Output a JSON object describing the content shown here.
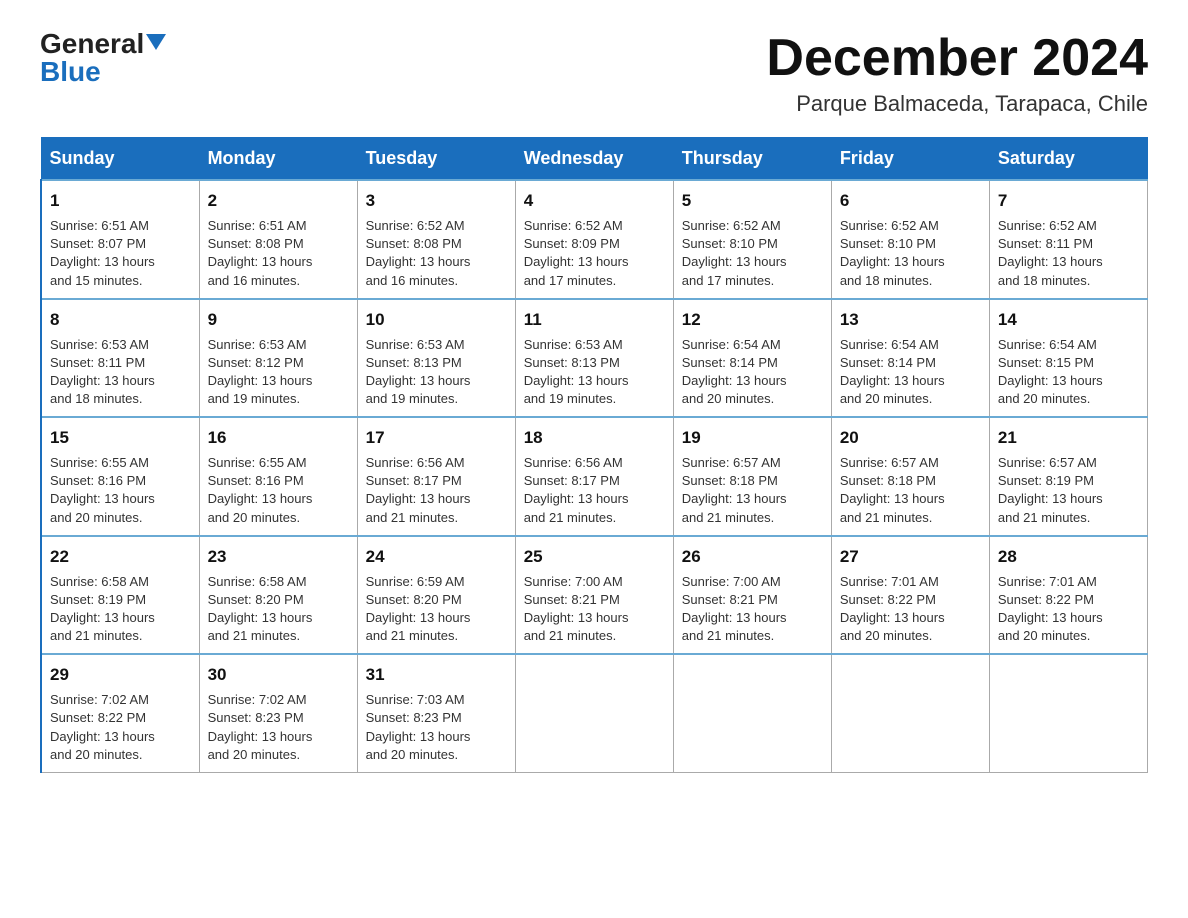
{
  "header": {
    "logo_general": "General",
    "logo_blue": "Blue",
    "title": "December 2024",
    "location": "Parque Balmaceda, Tarapaca, Chile"
  },
  "days_of_week": [
    "Sunday",
    "Monday",
    "Tuesday",
    "Wednesday",
    "Thursday",
    "Friday",
    "Saturday"
  ],
  "weeks": [
    [
      {
        "day": "1",
        "sunrise": "6:51 AM",
        "sunset": "8:07 PM",
        "daylight": "13 hours and 15 minutes."
      },
      {
        "day": "2",
        "sunrise": "6:51 AM",
        "sunset": "8:08 PM",
        "daylight": "13 hours and 16 minutes."
      },
      {
        "day": "3",
        "sunrise": "6:52 AM",
        "sunset": "8:08 PM",
        "daylight": "13 hours and 16 minutes."
      },
      {
        "day": "4",
        "sunrise": "6:52 AM",
        "sunset": "8:09 PM",
        "daylight": "13 hours and 17 minutes."
      },
      {
        "day": "5",
        "sunrise": "6:52 AM",
        "sunset": "8:10 PM",
        "daylight": "13 hours and 17 minutes."
      },
      {
        "day": "6",
        "sunrise": "6:52 AM",
        "sunset": "8:10 PM",
        "daylight": "13 hours and 18 minutes."
      },
      {
        "day": "7",
        "sunrise": "6:52 AM",
        "sunset": "8:11 PM",
        "daylight": "13 hours and 18 minutes."
      }
    ],
    [
      {
        "day": "8",
        "sunrise": "6:53 AM",
        "sunset": "8:11 PM",
        "daylight": "13 hours and 18 minutes."
      },
      {
        "day": "9",
        "sunrise": "6:53 AM",
        "sunset": "8:12 PM",
        "daylight": "13 hours and 19 minutes."
      },
      {
        "day": "10",
        "sunrise": "6:53 AM",
        "sunset": "8:13 PM",
        "daylight": "13 hours and 19 minutes."
      },
      {
        "day": "11",
        "sunrise": "6:53 AM",
        "sunset": "8:13 PM",
        "daylight": "13 hours and 19 minutes."
      },
      {
        "day": "12",
        "sunrise": "6:54 AM",
        "sunset": "8:14 PM",
        "daylight": "13 hours and 20 minutes."
      },
      {
        "day": "13",
        "sunrise": "6:54 AM",
        "sunset": "8:14 PM",
        "daylight": "13 hours and 20 minutes."
      },
      {
        "day": "14",
        "sunrise": "6:54 AM",
        "sunset": "8:15 PM",
        "daylight": "13 hours and 20 minutes."
      }
    ],
    [
      {
        "day": "15",
        "sunrise": "6:55 AM",
        "sunset": "8:16 PM",
        "daylight": "13 hours and 20 minutes."
      },
      {
        "day": "16",
        "sunrise": "6:55 AM",
        "sunset": "8:16 PM",
        "daylight": "13 hours and 20 minutes."
      },
      {
        "day": "17",
        "sunrise": "6:56 AM",
        "sunset": "8:17 PM",
        "daylight": "13 hours and 21 minutes."
      },
      {
        "day": "18",
        "sunrise": "6:56 AM",
        "sunset": "8:17 PM",
        "daylight": "13 hours and 21 minutes."
      },
      {
        "day": "19",
        "sunrise": "6:57 AM",
        "sunset": "8:18 PM",
        "daylight": "13 hours and 21 minutes."
      },
      {
        "day": "20",
        "sunrise": "6:57 AM",
        "sunset": "8:18 PM",
        "daylight": "13 hours and 21 minutes."
      },
      {
        "day": "21",
        "sunrise": "6:57 AM",
        "sunset": "8:19 PM",
        "daylight": "13 hours and 21 minutes."
      }
    ],
    [
      {
        "day": "22",
        "sunrise": "6:58 AM",
        "sunset": "8:19 PM",
        "daylight": "13 hours and 21 minutes."
      },
      {
        "day": "23",
        "sunrise": "6:58 AM",
        "sunset": "8:20 PM",
        "daylight": "13 hours and 21 minutes."
      },
      {
        "day": "24",
        "sunrise": "6:59 AM",
        "sunset": "8:20 PM",
        "daylight": "13 hours and 21 minutes."
      },
      {
        "day": "25",
        "sunrise": "7:00 AM",
        "sunset": "8:21 PM",
        "daylight": "13 hours and 21 minutes."
      },
      {
        "day": "26",
        "sunrise": "7:00 AM",
        "sunset": "8:21 PM",
        "daylight": "13 hours and 21 minutes."
      },
      {
        "day": "27",
        "sunrise": "7:01 AM",
        "sunset": "8:22 PM",
        "daylight": "13 hours and 20 minutes."
      },
      {
        "day": "28",
        "sunrise": "7:01 AM",
        "sunset": "8:22 PM",
        "daylight": "13 hours and 20 minutes."
      }
    ],
    [
      {
        "day": "29",
        "sunrise": "7:02 AM",
        "sunset": "8:22 PM",
        "daylight": "13 hours and 20 minutes."
      },
      {
        "day": "30",
        "sunrise": "7:02 AM",
        "sunset": "8:23 PM",
        "daylight": "13 hours and 20 minutes."
      },
      {
        "day": "31",
        "sunrise": "7:03 AM",
        "sunset": "8:23 PM",
        "daylight": "13 hours and 20 minutes."
      },
      null,
      null,
      null,
      null
    ]
  ]
}
